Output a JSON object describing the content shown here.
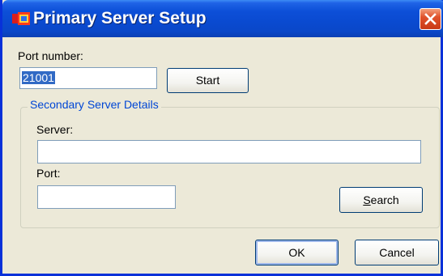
{
  "window": {
    "title": "Primary Server Setup",
    "icon": "app-logo-icon",
    "close_icon": "close-icon"
  },
  "port_number": {
    "label": "Port number:",
    "value": "21001"
  },
  "start_button": {
    "label": "Start"
  },
  "secondary": {
    "legend": "Secondary Server Details",
    "server_label": "Server:",
    "server_value": "",
    "port_label": "Port:",
    "port_value": "",
    "search_label_underlined": "S",
    "search_label_rest": "earch"
  },
  "footer": {
    "ok_label": "OK",
    "cancel_label": "Cancel"
  },
  "colors": {
    "titlebar": "#0a4ad0",
    "dialog_bg": "#ece9d8",
    "group_legend": "#0046d5",
    "selection": "#316ac5",
    "close_button": "#e0522b"
  }
}
